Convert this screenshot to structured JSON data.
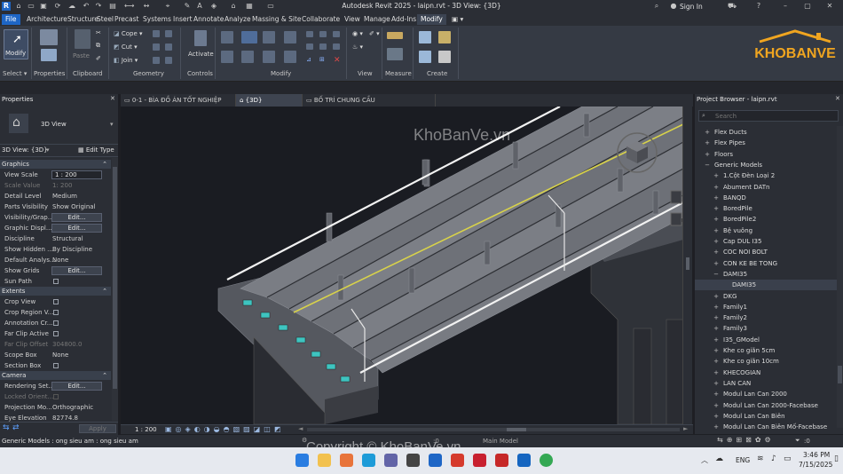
{
  "app": {
    "window_title": "Autodesk Revit 2025 - laipn.rvt - 3D View: {3D}",
    "sign_in": "Sign In",
    "watermark_logo": "KHOBANVE",
    "watermark_center": "KhoBanVe.vn",
    "watermark_bottom": "Copyright © KhoBanVe.vn"
  },
  "menu": {
    "tabs": [
      "File",
      "Architecture",
      "Structure",
      "Steel",
      "Precast",
      "Systems",
      "Insert",
      "Annotate",
      "Analyze",
      "Massing & Site",
      "Collaborate",
      "View",
      "Manage",
      "Add-Ins",
      "Modify"
    ],
    "active": "Modify"
  },
  "ribbon": {
    "groups": {
      "select": "Select ▾",
      "properties": "Properties",
      "clipboard": "Clipboard",
      "geometry": "Geometry",
      "controls": "Controls",
      "modify": "Modify",
      "view": "View",
      "measure": "Measure",
      "create": "Create"
    },
    "buttons": {
      "modify": "Modify",
      "paste": "Paste",
      "cope": "Cope",
      "cut": "Cut",
      "join": "Join",
      "activate": "Activate"
    }
  },
  "properties": {
    "title": "Properties",
    "type_name": "3D View",
    "view_selector": "3D View: {3D}",
    "edit_type": "Edit Type",
    "sections": {
      "graphics": "Graphics",
      "extents": "Extents",
      "camera": "Camera"
    },
    "graphics_rows": [
      {
        "k": "View Scale",
        "v": "1 : 200",
        "kind": "field"
      },
      {
        "k": "Scale Value",
        "v": "1:  200",
        "kind": "dim"
      },
      {
        "k": "Detail Level",
        "v": "Medium",
        "kind": "text"
      },
      {
        "k": "Parts Visibility",
        "v": "Show Original",
        "kind": "text"
      },
      {
        "k": "Visibility/Grap...",
        "v": "Edit...",
        "kind": "button"
      },
      {
        "k": "Graphic Displ...",
        "v": "Edit...",
        "kind": "button"
      },
      {
        "k": "Discipline",
        "v": "Structural",
        "kind": "text"
      },
      {
        "k": "Show Hidden ...",
        "v": "By Discipline",
        "kind": "text"
      },
      {
        "k": "Default Analys...",
        "v": "None",
        "kind": "text"
      },
      {
        "k": "Show Grids",
        "v": "Edit...",
        "kind": "button"
      },
      {
        "k": "Sun Path",
        "v": "",
        "kind": "check"
      }
    ],
    "extents_rows": [
      {
        "k": "Crop View",
        "v": "",
        "kind": "check"
      },
      {
        "k": "Crop Region V...",
        "v": "",
        "kind": "check"
      },
      {
        "k": "Annotation Cr...",
        "v": "",
        "kind": "check"
      },
      {
        "k": "Far Clip Active",
        "v": "",
        "kind": "check"
      },
      {
        "k": "Far Clip Offset",
        "v": "304800.0",
        "kind": "dim"
      },
      {
        "k": "Scope Box",
        "v": "None",
        "kind": "text"
      },
      {
        "k": "Section Box",
        "v": "",
        "kind": "check"
      }
    ],
    "camera_rows": [
      {
        "k": "Rendering Set...",
        "v": "Edit...",
        "kind": "button"
      },
      {
        "k": "Locked Orient...",
        "v": "",
        "kind": "dimcheck"
      },
      {
        "k": "Projection Mo...",
        "v": "Orthographic",
        "kind": "text"
      },
      {
        "k": "Eye Elevation",
        "v": "82774.8",
        "kind": "text"
      }
    ],
    "apply": "Apply"
  },
  "view_tabs": [
    {
      "label": "0-1 - BÌA ĐỒ ÁN TỐT NGHIỆP",
      "active": false
    },
    {
      "label": "{3D}",
      "active": true
    },
    {
      "label": "BỐ TRÍ CHUNG CẦU",
      "active": false
    }
  ],
  "view_control_bar": {
    "scale": "1 : 200"
  },
  "project_browser": {
    "title": "Project Browser - laipn.rvt",
    "search_placeholder": "Search",
    "items": [
      {
        "label": "Flex Ducts",
        "level": 0,
        "state": "+"
      },
      {
        "label": "Flex Pipes",
        "level": 0,
        "state": "+"
      },
      {
        "label": "Floors",
        "level": 0,
        "state": "+"
      },
      {
        "label": "Generic Models",
        "level": 0,
        "state": "−"
      },
      {
        "label": "1.Cột Đèn Loại 2",
        "level": 1,
        "state": "+"
      },
      {
        "label": "Abument DATn",
        "level": 1,
        "state": "+"
      },
      {
        "label": "BANQD",
        "level": 1,
        "state": "+"
      },
      {
        "label": "BoredPile",
        "level": 1,
        "state": "+"
      },
      {
        "label": "BoredPile2",
        "level": 1,
        "state": "+"
      },
      {
        "label": "Bệ vuông",
        "level": 1,
        "state": "+"
      },
      {
        "label": "Cap DUL I35",
        "level": 1,
        "state": "+"
      },
      {
        "label": "COC NOI BOLT",
        "level": 1,
        "state": "+"
      },
      {
        "label": "CON KE BE TONG",
        "level": 1,
        "state": "+"
      },
      {
        "label": "DAMI35",
        "level": 1,
        "state": "−"
      },
      {
        "label": "DAMI35",
        "level": 2,
        "state": "",
        "selected": true
      },
      {
        "label": "DKG",
        "level": 1,
        "state": "+"
      },
      {
        "label": "Family1",
        "level": 1,
        "state": "+"
      },
      {
        "label": "Family2",
        "level": 1,
        "state": "+"
      },
      {
        "label": "Family3",
        "level": 1,
        "state": "+"
      },
      {
        "label": "I35_GModel",
        "level": 1,
        "state": "+"
      },
      {
        "label": "Khe co giãn 5cm",
        "level": 1,
        "state": "+"
      },
      {
        "label": "Khe co giãn 10cm",
        "level": 1,
        "state": "+"
      },
      {
        "label": "KHECOGIAN",
        "level": 1,
        "state": "+"
      },
      {
        "label": "LAN CAN",
        "level": 1,
        "state": "+"
      },
      {
        "label": "Modul Lan Can 2000",
        "level": 1,
        "state": "+"
      },
      {
        "label": "Modul Lan Can 2000-Facebase",
        "level": 1,
        "state": "+"
      },
      {
        "label": "Modul Lan Can Biên",
        "level": 1,
        "state": "+"
      },
      {
        "label": "Modul Lan Can Biên Mố-Facebase",
        "level": 1,
        "state": "+"
      }
    ]
  },
  "status": {
    "left": "Generic Models : ong sieu am : ong sieu am",
    "center_value": ":0",
    "main_model": "Main Model",
    "right_count": ":0"
  },
  "taskbar": {
    "language": "ENG",
    "time": "3:46 PM",
    "date": "7/15/2025"
  }
}
